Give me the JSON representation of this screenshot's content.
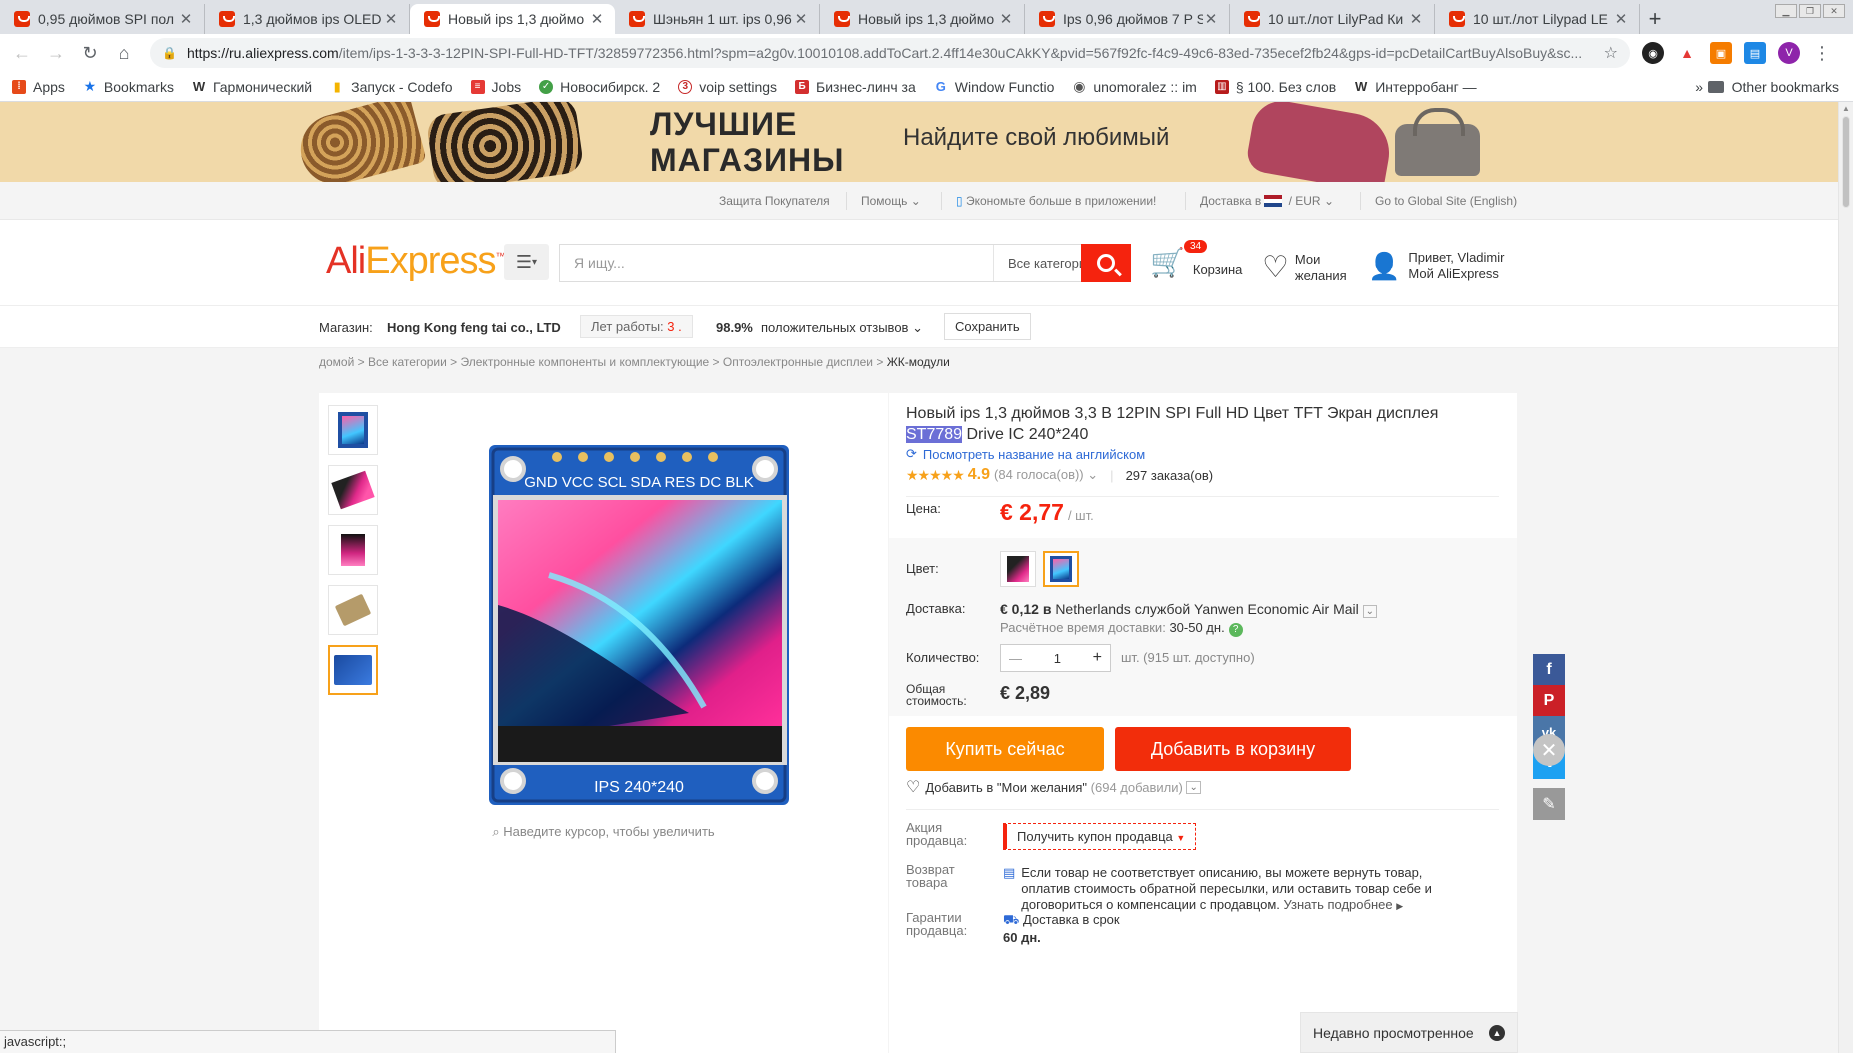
{
  "tabs": [
    {
      "title": "0,95 дюймов SPI пол"
    },
    {
      "title": "1,3 дюймов ips OLED"
    },
    {
      "title": "Новый ips 1,3 дюймо",
      "active": true
    },
    {
      "title": "Шэньян 1 шт. ips 0,96"
    },
    {
      "title": "Новый ips 1,3 дюймо"
    },
    {
      "title": "Ips 0,96 дюймов 7 P S"
    },
    {
      "title": "10 шт./лот LilyPad Ки"
    },
    {
      "title": "10 шт./лот Lilypad LE"
    }
  ],
  "address": {
    "domain": "https://ru.aliexpress.com",
    "path": "/item/ips-1-3-3-3-12PIN-SPI-Full-HD-TFT/32859772356.html?spm=a2g0v.10010108.addToCart.2.4ff14e30uCAkKY&pvid=567f92fc-f4c9-49c6-83ed-735ecef2fb24&gps-id=pcDetailCartBuyAlsoBuy&sc..."
  },
  "bookmarks": [
    {
      "label": "Apps",
      "icon": "apps-grid-icon",
      "color": "#e64a19"
    },
    {
      "label": "Bookmarks",
      "icon": "star-icon",
      "color": "#1a73e8"
    },
    {
      "label": "Гармонический",
      "icon": "wikipedia-icon",
      "color": "#333333"
    },
    {
      "label": "Запуск - Codefo",
      "icon": "chart-icon",
      "color": "#f4b400"
    },
    {
      "label": "Jobs",
      "icon": "bars-icon",
      "color": "#e53935"
    },
    {
      "label": "Новосибирск. 2",
      "icon": "leaf-icon",
      "color": "#43a047"
    },
    {
      "label": "voip settings",
      "icon": "number-3-icon",
      "color": "#c62828"
    },
    {
      "label": "Бизнес-линч за",
      "icon": "book-icon",
      "color": "#d32f2f"
    },
    {
      "label": "Window Functio",
      "icon": "google-icon",
      "color": "#4285f4"
    },
    {
      "label": "unomoralez :: im",
      "icon": "eye-icon",
      "color": "#555555"
    },
    {
      "label": "§ 100. Без слов",
      "icon": "library-icon",
      "color": "#b71c1c"
    },
    {
      "label": "Интерробанг —",
      "icon": "wikipedia-icon",
      "color": "#333333"
    }
  ],
  "bookmarks_more": "»",
  "other_bookmarks": "Other bookmarks",
  "banner": {
    "title": "ЛУЧШИЕ МАГАЗИНЫ",
    "subtitle": "Найдите свой любимый"
  },
  "topnav": {
    "protection": "Защита Покупателя",
    "help": "Помощь",
    "app": "Экономьте больше в приложении!",
    "ship_to": "Доставка в",
    "currency": "EUR",
    "global": "Go to Global Site (English)"
  },
  "header": {
    "logo_ali": "Ali",
    "logo_express": "Express",
    "search_placeholder": "Я ищу...",
    "search_category": "Все категории",
    "cart_count": "34",
    "cart_label": "Корзина",
    "wish_label_1": "Мои",
    "wish_label_2": "желания",
    "user_greeting": "Привет, Vladimir",
    "user_account": "Мой AliExpress"
  },
  "store": {
    "label": "Магазин:",
    "name": "Hong Kong feng tai co., LTD",
    "years_label": "Лет работы:",
    "years": "3 .",
    "positive_pct": "98.9%",
    "positive_label": "положительных отзывов",
    "save": "Сохранить"
  },
  "breadcrumbs": [
    "домой",
    "Все категории",
    "Электронные компоненты и комплектующие",
    "Оптоэлектронные дисплеи",
    "ЖК-модули"
  ],
  "gallery": {
    "zoom_hint": "Наведите курсор, чтобы увеличить",
    "pcb_label_top": "GND VCC SCL SDA RES DC BLK",
    "pcb_label_bottom": "IPS 240*240"
  },
  "product": {
    "title_part1": "Новый ips 1,3 дюймов 3,3 В 12PIN SPI Full HD Цвет TFT Экран дисплея",
    "title_highlight": "ST7789",
    "title_part2": "Drive IC 240*240",
    "english_name": "Посмотреть название на английском",
    "stars": "★★★★★",
    "rating": "4.9",
    "votes": "(84 голоса(ов))",
    "orders": "297 заказа(ов)",
    "price_label": "Цена:",
    "price": "€ 2,77",
    "price_unit": "/ шт.",
    "color_label": "Цвет:",
    "shipping_label": "Доставка:",
    "shipping_price": "€ 0,12 в",
    "shipping_service": "Netherlands службой Yanwen Economic Air Mail",
    "delivery_time_label": "Расчётное время доставки:",
    "delivery_time": "30-50 дн.",
    "qty_label": "Количество:",
    "qty": "1",
    "qty_avail": "шт. (915 шт. доступно)",
    "total_label_1": "Общая",
    "total_label_2": "стоимость:",
    "total": "€ 2,89",
    "buy_now": "Купить сейчас",
    "add_to_cart": "Добавить в корзину",
    "add_wish": "Добавить в \"Мои желания\"",
    "wish_count": "(694 добавили)",
    "promo_label_1": "Акция",
    "promo_label_2": "продавца:",
    "coupon": "Получить купон продавца",
    "return_label_1": "Возврат",
    "return_label_2": "товара",
    "return_text": "Если товар не соответствует описанию, вы можете вернуть товар, оплатив стоимость обратной пересылки, или оставить товар себе и договориться о компенсации с продавцом.",
    "return_more": "Узнать подробнее",
    "guarantee_label_1": "Гарантии",
    "guarantee_label_2": "продавца:",
    "guarantee_text": "Доставка в срок",
    "guarantee_days": "60 дн."
  },
  "recent": "Недавно просмотренное",
  "status": "javascript:;",
  "colors": {
    "accent": "#f5230e",
    "orange": "#fb8a00",
    "link": "#2e6ad6"
  }
}
